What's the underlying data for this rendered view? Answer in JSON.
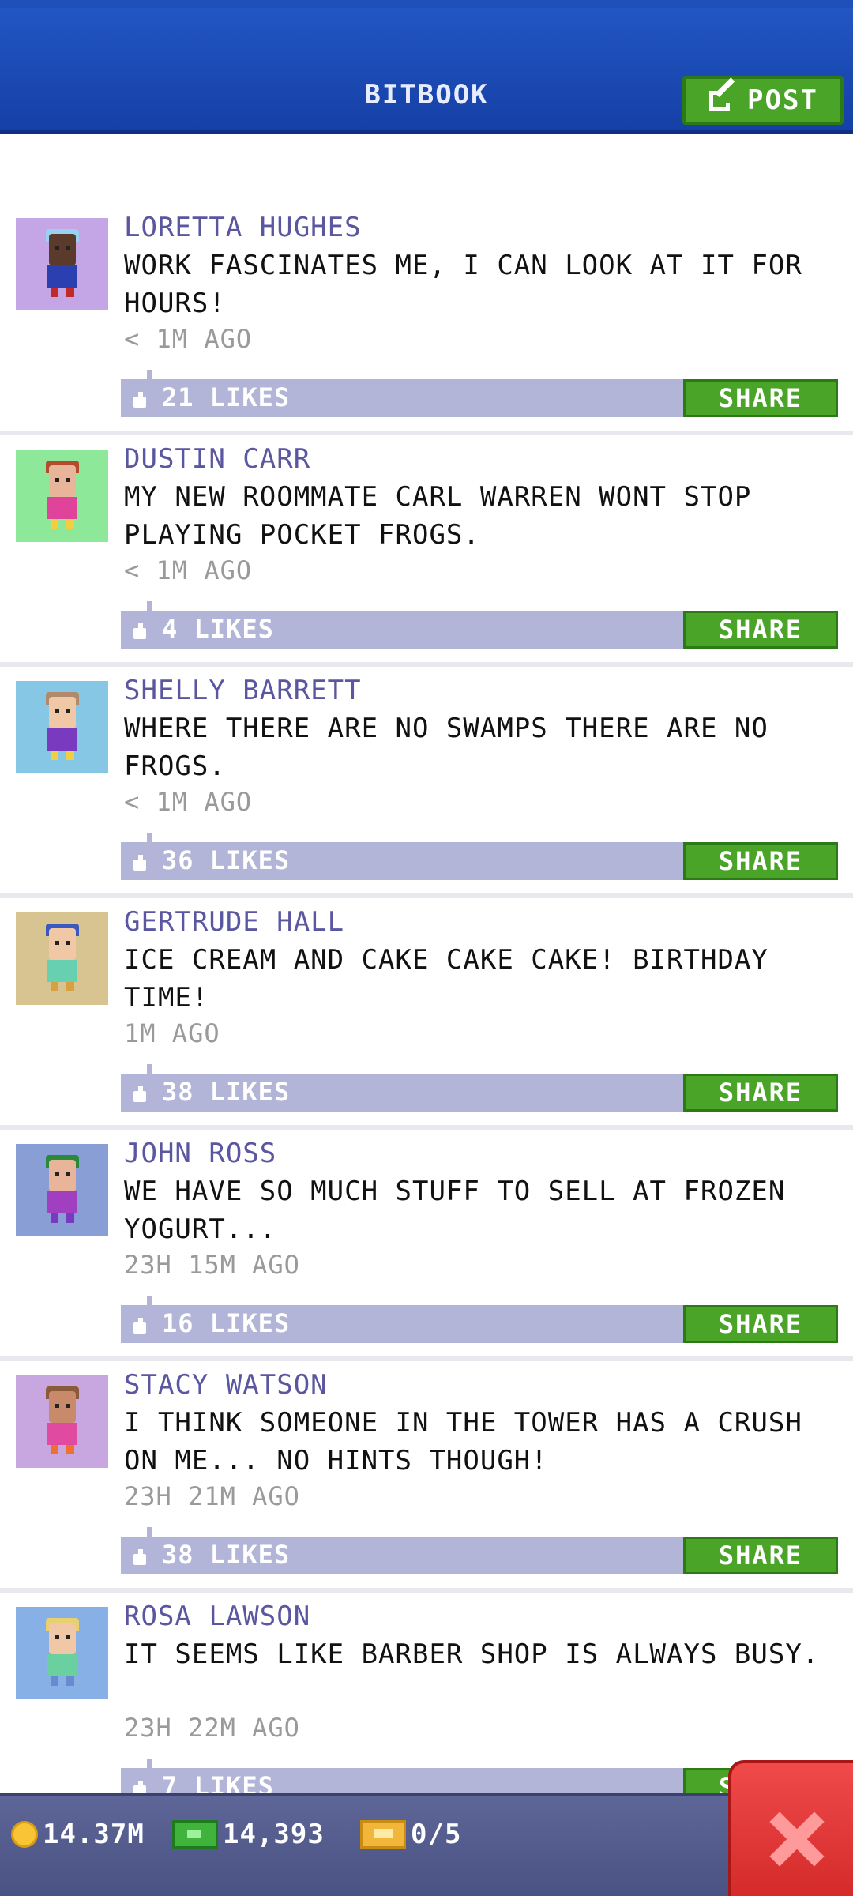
{
  "header": {
    "title": "BITBOOK",
    "post_label": "POST"
  },
  "posts": [
    {
      "name": "LORETTA HUGHES",
      "message": "WORK FASCINATES ME, I CAN LOOK AT IT FOR HOURS!",
      "time": "< 1M AGO",
      "likes": "21 LIKES",
      "share": "SHARE"
    },
    {
      "name": "DUSTIN CARR",
      "message": "MY NEW ROOMMATE CARL WARREN WONT STOP PLAYING POCKET FROGS.",
      "time": "< 1M AGO",
      "likes": "4 LIKES",
      "share": "SHARE"
    },
    {
      "name": "SHELLY BARRETT",
      "message": "WHERE THERE ARE NO SWAMPS THERE ARE NO FROGS.",
      "time": "< 1M AGO",
      "likes": "36 LIKES",
      "share": "SHARE"
    },
    {
      "name": "GERTRUDE HALL",
      "message": "ICE CREAM AND CAKE CAKE CAKE! BIRTHDAY TIME!",
      "time": "1M AGO",
      "likes": "38 LIKES",
      "share": "SHARE"
    },
    {
      "name": "JOHN ROSS",
      "message": "WE HAVE SO MUCH STUFF TO SELL AT FROZEN YOGURT...",
      "time": "23H 15M AGO",
      "likes": "16 LIKES",
      "share": "SHARE"
    },
    {
      "name": "STACY WATSON",
      "message": "I THINK SOMEONE IN THE TOWER HAS A CRUSH ON ME... NO HINTS THOUGH!",
      "time": "23H 21M AGO",
      "likes": "38 LIKES",
      "share": "SHARE"
    },
    {
      "name": "ROSA LAWSON",
      "message": "IT SEEMS LIKE BARBER SHOP IS ALWAYS BUSY.",
      "time": "23H 22M AGO",
      "likes": "7 LIKES",
      "share": "SHARE"
    }
  ],
  "avatars": [
    {
      "bg": "#c4a6e6",
      "skin": "#5a3a2a",
      "hair": "#9ad0f0",
      "shirt": "#2c3fb0",
      "legs": "#c02a2a"
    },
    {
      "bg": "#8ee89a",
      "skin": "#e8b59a",
      "hair": "#b44a2e",
      "shirt": "#e0449a",
      "legs": "#f0d040"
    },
    {
      "bg": "#86c7e6",
      "skin": "#f0c8a6",
      "hair": "#b08a6a",
      "shirt": "#7a3ac0",
      "legs": "#f0d040"
    },
    {
      "bg": "#d8c490",
      "skin": "#f0c8a6",
      "hair": "#3a58c0",
      "shirt": "#66d0b0",
      "legs": "#d8a040"
    },
    {
      "bg": "#8a9ed6",
      "skin": "#e8b59a",
      "hair": "#2a8a3a",
      "shirt": "#a040c0",
      "legs": "#7a3ac0"
    },
    {
      "bg": "#c8a6e0",
      "skin": "#c88a6a",
      "hair": "#8a5a3a",
      "shirt": "#e04aa0",
      "legs": "#f07030"
    },
    {
      "bg": "#86b0e6",
      "skin": "#f0c8a6",
      "hair": "#e8d070",
      "shirt": "#6ad0a0",
      "legs": "#6a8ad0"
    }
  ],
  "bottom_bar": {
    "coins": "14.37M",
    "bux": "14,393",
    "tickets": "0/5"
  },
  "colors": {
    "header_blue": "#1540a6",
    "share_green": "#4aa428",
    "likes_bar": "#b3b5d8",
    "name_purple": "#5a57a0",
    "close_red": "#e03a3a"
  },
  "icons": [
    "edit-icon",
    "like-icon",
    "coin-icon",
    "bux-icon",
    "ticket-icon",
    "close-icon"
  ]
}
